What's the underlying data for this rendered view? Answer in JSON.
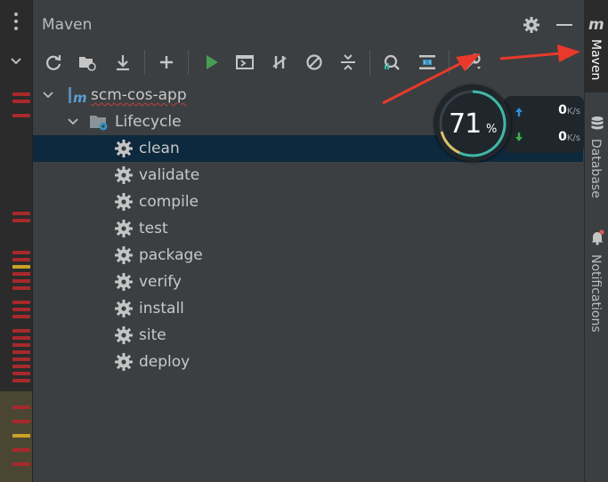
{
  "panel": {
    "title": "Maven"
  },
  "tree": {
    "project": "scm-cos-app",
    "lifecycle": "Lifecycle",
    "goals": [
      {
        "label": "clean",
        "selected": true
      },
      {
        "label": "validate"
      },
      {
        "label": "compile"
      },
      {
        "label": "test"
      },
      {
        "label": "package"
      },
      {
        "label": "verify"
      },
      {
        "label": "install"
      },
      {
        "label": "site"
      },
      {
        "label": "deploy"
      }
    ]
  },
  "toolbar": {
    "icons": [
      "reload-icon",
      "add-maven-project-icon",
      "download-icon",
      "add-icon",
      "run-icon",
      "execute-goal-icon",
      "toggle-offline-icon",
      "skip-tests-icon",
      "collapse-all-icon",
      "analyze-dependencies-icon",
      "show-diagram-icon",
      "settings-wrench-icon"
    ]
  },
  "right_stripe": {
    "maven_label": "Maven",
    "maven_logo": "m",
    "database_label": "Database",
    "notifications_label": "Notifications"
  },
  "network_widget": {
    "percent": "71",
    "percent_symbol": "%",
    "upload_value": "0",
    "upload_unit": "K/s",
    "download_value": "0",
    "download_unit": "K/s",
    "percent_value": 0.71
  },
  "colors": {
    "selection": "#0d293e",
    "run_green": "#499c54",
    "annotation_red": "#e8392b",
    "ring_accent": "#3fb8a8"
  }
}
